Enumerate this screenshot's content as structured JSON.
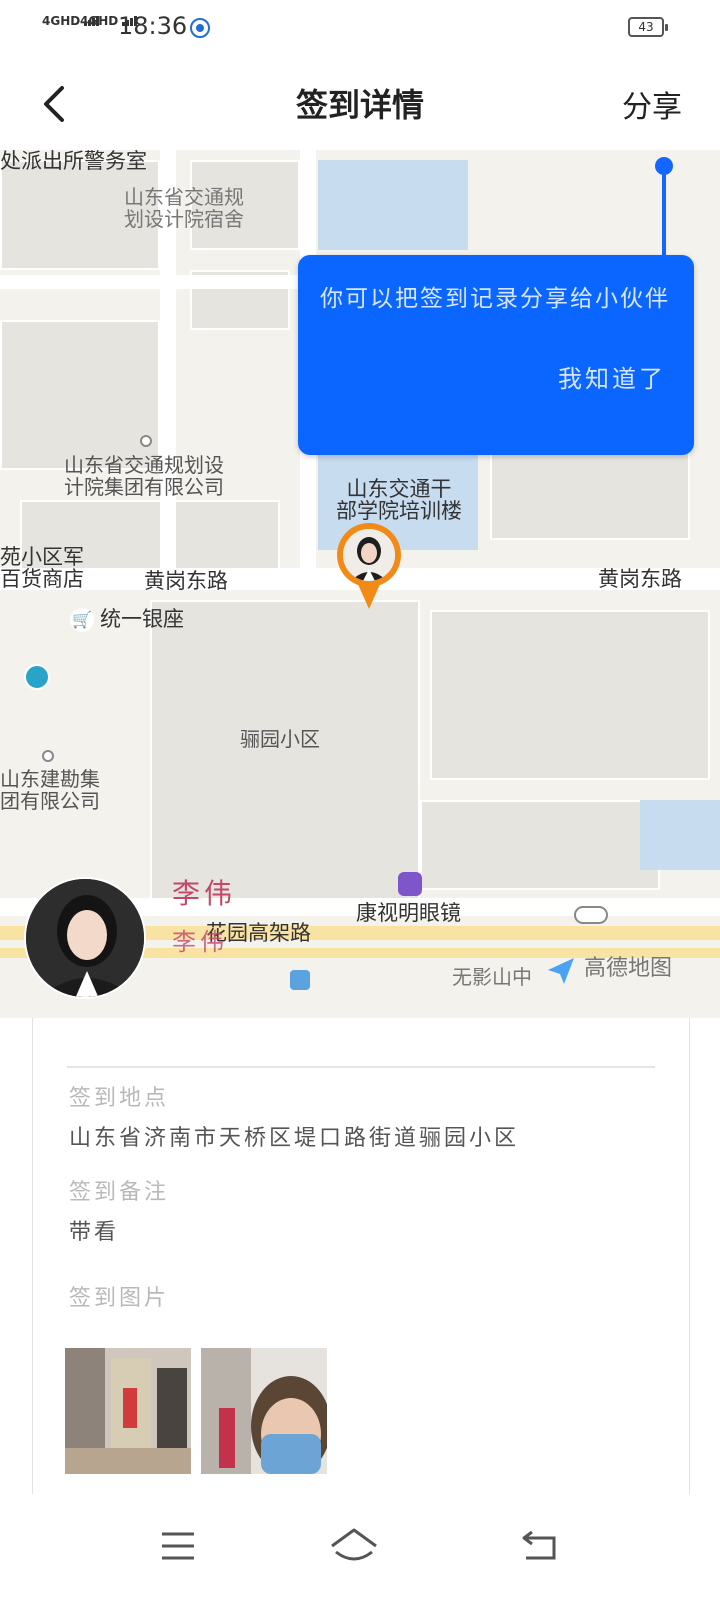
{
  "status_bar": {
    "net1": "4GHD",
    "net2": "4GHD",
    "time": "18:36",
    "battery": "43"
  },
  "header": {
    "title": "签到详情",
    "share": "分享"
  },
  "map": {
    "labels": {
      "police": "处派出所警务室",
      "dorm": "山东省交通规\n划设计院宿舍",
      "institute": "山东省交通规划设\n计院集团有限公司",
      "training": "山东交通干\n部学院培训楼",
      "shop": "苑小区军\n百货商店",
      "road_left": "黄岗东路",
      "road_right": "黄岗东路",
      "mall": "统一银座",
      "community": "骊园小区",
      "survey": "山东建勘集\n团有限公司",
      "glasses": "康视明眼镜",
      "elevated": "花园高架路",
      "wuying": "无影山中",
      "gaode": "高德地图"
    }
  },
  "tooltip": {
    "message": "你可以把签到记录分享给小伙伴",
    "ok": "我知道了"
  },
  "user": {
    "name": "李伟"
  },
  "detail": {
    "location_label": "签到地点",
    "location_value": "山东省济南市天桥区堤口路街道骊园小区",
    "note_label": "签到备注",
    "note_value": "带看",
    "photos_label": "签到图片"
  },
  "colors": {
    "tooltip": "#0a66ff",
    "marker": "#f28a18",
    "map_bg": "#f4f2ec"
  }
}
